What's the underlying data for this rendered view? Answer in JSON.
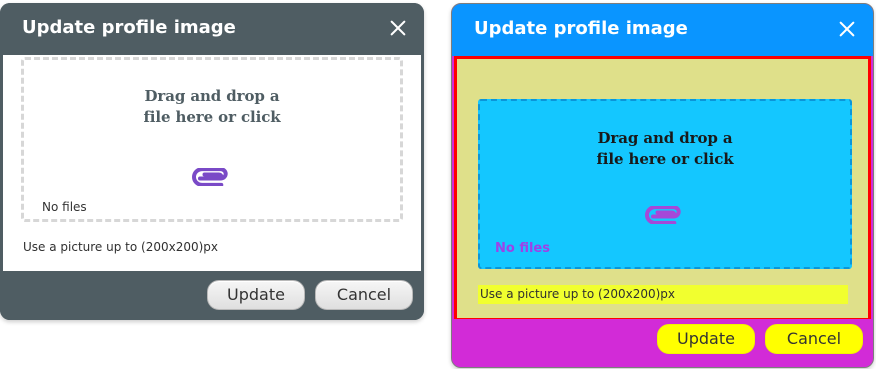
{
  "left_dialog": {
    "title": "Update profile image",
    "drop_text_line1": "Drag and drop a",
    "drop_text_line2": "file here or click",
    "no_files": "No files",
    "hint": "Use a picture up to (200x200)px",
    "update_label": "Update",
    "cancel_label": "Cancel",
    "colors": {
      "header": "#4f5d63",
      "body": "#ffffff",
      "accent": "#7a4ac7"
    }
  },
  "right_dialog": {
    "title": "Update profile image",
    "drop_text_line1": "Drag and drop a",
    "drop_text_line2": "file here or click",
    "no_files": "No files",
    "hint": "Use a picture up to (200x200)px",
    "update_label": "Update",
    "cancel_label": "Cancel",
    "colors": {
      "header": "#0a95ff",
      "body": "#dfe08a",
      "dropzone": "#14c7ff",
      "footer": "#d22bd7",
      "button": "#ffff00",
      "highlight_border": "#ff0000"
    }
  },
  "icons": {
    "close": "close-icon",
    "attachment": "paperclip-icon"
  }
}
